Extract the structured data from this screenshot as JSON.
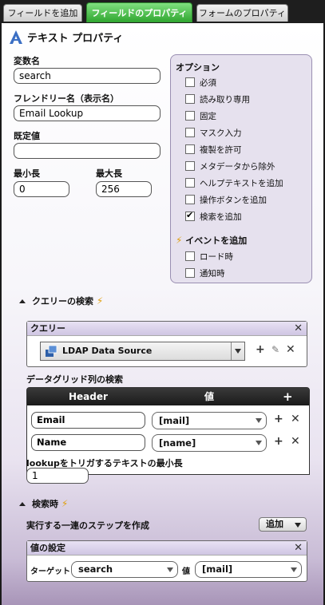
{
  "tabs": [
    "フィールドを追加",
    "フィールドのプロパティ",
    "フォームのプロパティ"
  ],
  "panel_title": "テキスト プロパティ",
  "fields": {
    "var_name_label": "変数名",
    "var_name_value": "search",
    "friendly_label": "フレンドリー名（表示名）",
    "friendly_value": "Email Lookup",
    "default_label": "既定値",
    "default_value": "",
    "min_label": "最小長",
    "min_value": "0",
    "max_label": "最大長",
    "max_value": "256"
  },
  "options": {
    "title": "オプション",
    "items": [
      {
        "label": "必須",
        "checked": false
      },
      {
        "label": "読み取り専用",
        "checked": false
      },
      {
        "label": "固定",
        "checked": false
      },
      {
        "label": "マスク入力",
        "checked": false
      },
      {
        "label": "複製を許可",
        "checked": false
      },
      {
        "label": "メタデータから除外",
        "checked": false
      },
      {
        "label": "ヘルプテキストを追加",
        "checked": false
      },
      {
        "label": "操作ボタンを追加",
        "checked": false
      },
      {
        "label": "検索を追加",
        "checked": true
      }
    ],
    "events_title": "イベントを追加",
    "events": [
      {
        "label": "ロード時",
        "checked": false
      },
      {
        "label": "通知時",
        "checked": false
      }
    ]
  },
  "query_section": {
    "title": "クエリーの検索",
    "query_box_title": "クエリー",
    "source_value": "LDAP Data Source",
    "grid_title": "データグリッド列の検索",
    "grid_headers": {
      "header": "Header",
      "value": "値"
    },
    "rows": [
      {
        "header": "Email",
        "value": "[mail]"
      },
      {
        "header": "Name",
        "value": "[name]"
      }
    ],
    "min_lookup_label": "lookupをトリガするテキストの最小長",
    "min_lookup_value": "1"
  },
  "search_section": {
    "title": "検索時",
    "steps_label": "実行する一連のステップを作成",
    "add_button": "追加",
    "set_value_title": "値の設定",
    "target_label": "ターゲット",
    "target_value": "search",
    "value_label": "値",
    "value_value": "[mail]"
  },
  "colors": {
    "active_tab": "#2fa52f",
    "accent": "#e0a010",
    "panel_purple": "#a895b8"
  }
}
